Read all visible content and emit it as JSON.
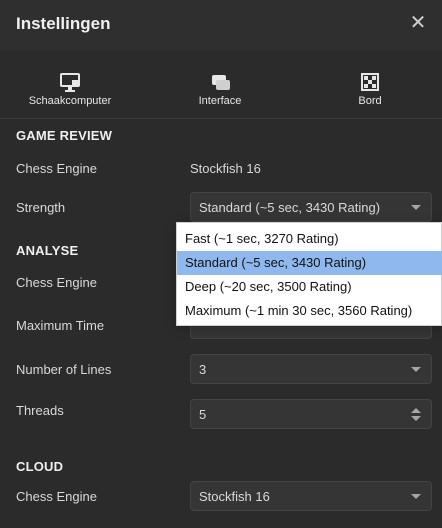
{
  "dialog": {
    "title": "Instellingen",
    "close_icon": "close-icon"
  },
  "tabs": [
    {
      "label": "Schaakcomputer",
      "icon": "chess-computer-icon"
    },
    {
      "label": "Interface",
      "icon": "windows-icon"
    },
    {
      "label": "Bord",
      "icon": "chessboard-icon"
    }
  ],
  "game_review": {
    "title": "GAME REVIEW",
    "engine_label": "Chess Engine",
    "engine_value": "Stockfish 16",
    "strength_label": "Strength",
    "strength_value": "Standard (~5 sec, 3430 Rating)"
  },
  "analyse": {
    "title": "ANALYSE",
    "engine_label": "Chess Engine",
    "maximum_time_label": "Maximum Time",
    "number_of_lines_label": "Number of Lines",
    "number_of_lines_value": "3",
    "threads_label": "Threads",
    "threads_value": "5"
  },
  "cloud": {
    "title": "CLOUD",
    "engine_label": "Chess Engine",
    "engine_value": "Stockfish 16"
  },
  "strength_dropdown": {
    "options": [
      "Fast (~1 sec, 3270 Rating)",
      "Standard (~5 sec, 3430 Rating)",
      "Deep (~20 sec, 3500 Rating)",
      "Maximum (~1 min 30 sec, 3560 Rating)"
    ],
    "selected_index": 1
  },
  "colors": {
    "background": "#2b2b2b",
    "dropdown_selected": "#8fb8ef"
  }
}
